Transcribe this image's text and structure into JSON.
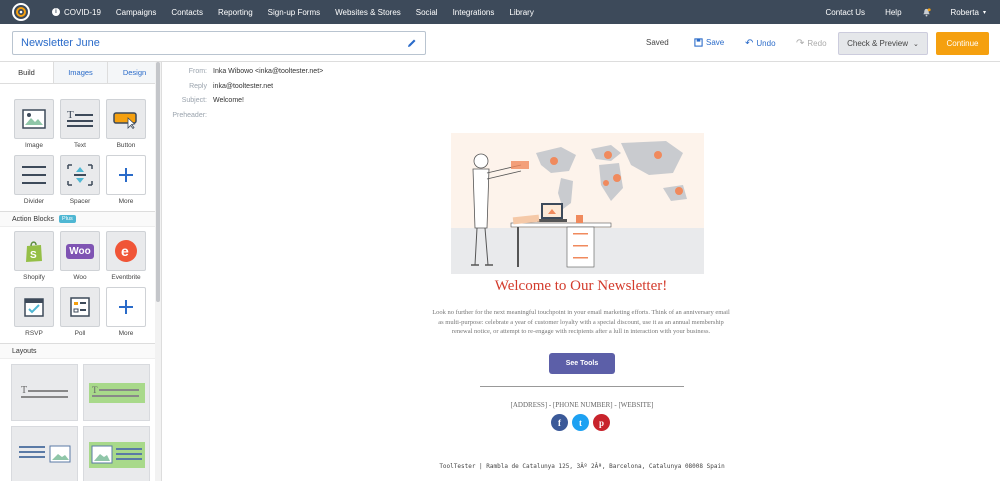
{
  "topnav": {
    "items": [
      "COVID-19",
      "Campaigns",
      "Contacts",
      "Reporting",
      "Sign-up Forms",
      "Websites & Stores",
      "Social",
      "Integrations",
      "Library"
    ],
    "right": [
      "Contact Us",
      "Help",
      "Roberta"
    ]
  },
  "header": {
    "title": "Newsletter June",
    "saved": "Saved",
    "save": "Save",
    "undo": "Undo",
    "redo": "Redo",
    "check_preview": "Check & Preview",
    "continue": "Continue"
  },
  "sidebar": {
    "tabs": [
      "Build",
      "Images",
      "Design"
    ],
    "blocks": [
      "Image",
      "Text",
      "Button",
      "Divider",
      "Spacer",
      "More"
    ],
    "action_blocks_title": "Action Blocks",
    "plus_badge": "Plus",
    "action_blocks": [
      "Shopify",
      "Woo",
      "Eventbrite",
      "RSVP",
      "Poll",
      "More"
    ],
    "woo_logo": "Woo",
    "layouts_title": "Layouts"
  },
  "email_meta": {
    "from_label": "From:",
    "from_value": "Inka Wibowo <inka@tooltester.net>",
    "reply_label": "Reply",
    "reply_value": "inka@tooltester.net",
    "subject_label": "Subject:",
    "subject_value": "Welcome!",
    "preheader_label": "Preheader:"
  },
  "email": {
    "title": "Welcome to Our Newsletter!",
    "text": "Look no further for the next meaningful touchpoint in your email marketing efforts. Think of an anniversary email as multi-purpose: celebrate a year of customer loyalty with a special discount, use it as an annual membership renewal notice, or attempt to re-engage with recipients after a lull in interaction with your business.",
    "button": "See Tools",
    "contact_line": "[ADDRESS] - [PHONE NUMBER] - [WEBSITE]",
    "social": [
      "f",
      "t",
      "p"
    ],
    "footer": "ToolTester | Rambla de Catalunya 125, 3Âº 2Âª, Barcelona, Catalunya 08008 Spain"
  },
  "colors": {
    "nav_bg": "#3d4a5a",
    "accent": "#2a6bc9",
    "continue": "#f5a00f",
    "headline": "#d33b2c",
    "button": "#5c5fa8"
  }
}
